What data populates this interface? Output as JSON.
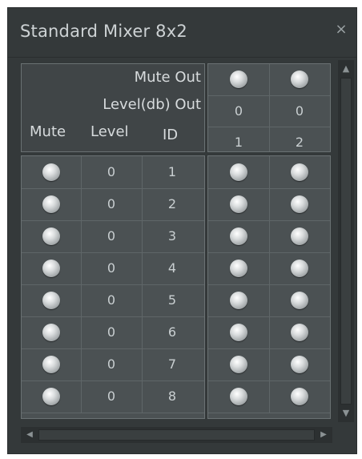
{
  "window": {
    "title": "Standard Mixer 8x2",
    "close_glyph": "×"
  },
  "header": {
    "mute_out_label": "Mute Out",
    "level_out_label": "Level(db) Out",
    "mute_label": "Mute",
    "level_label": "Level",
    "id_label": "ID"
  },
  "outputs": [
    {
      "level": "0",
      "id": "1"
    },
    {
      "level": "0",
      "id": "2"
    }
  ],
  "inputs": [
    {
      "level": "0",
      "id": "1"
    },
    {
      "level": "0",
      "id": "2"
    },
    {
      "level": "0",
      "id": "3"
    },
    {
      "level": "0",
      "id": "4"
    },
    {
      "level": "0",
      "id": "5"
    },
    {
      "level": "0",
      "id": "6"
    },
    {
      "level": "0",
      "id": "7"
    },
    {
      "level": "0",
      "id": "8"
    }
  ],
  "scroll": {
    "up_glyph": "▲",
    "down_glyph": "▼",
    "left_glyph": "◀",
    "right_glyph": "▶"
  }
}
